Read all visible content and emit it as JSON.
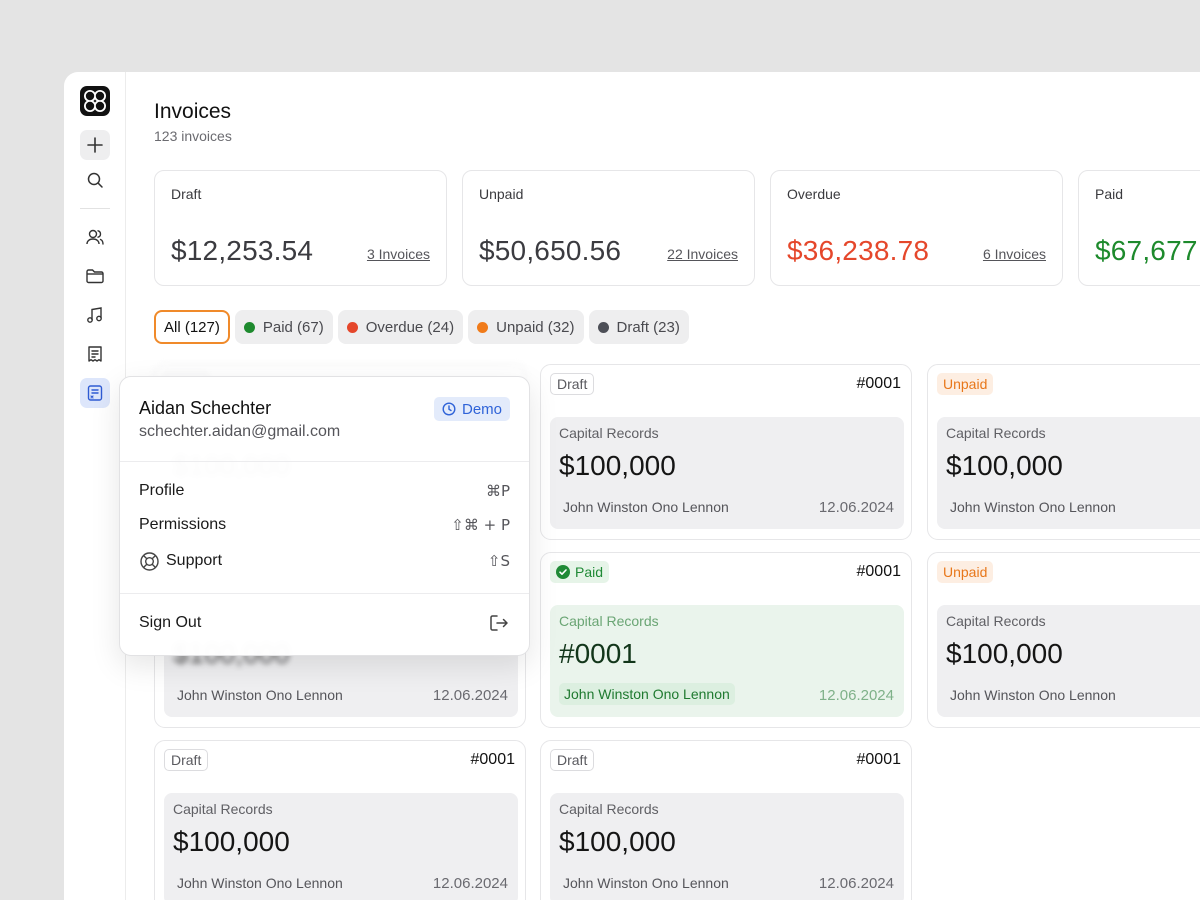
{
  "header": {
    "title": "Invoices",
    "subtitle": "123 invoices"
  },
  "summary": [
    {
      "label": "Draft",
      "amount": "$12,253.54",
      "link": "3 Invoices",
      "color": "#3b3b40"
    },
    {
      "label": "Unpaid",
      "amount": "$50,650.56",
      "link": "22 Invoices",
      "color": "#3b3b40"
    },
    {
      "label": "Overdue",
      "amount": "$36,238.78",
      "link": "6 Invoices",
      "color": "#e5472b"
    },
    {
      "label": "Paid",
      "amount": "$67,677.",
      "link": "",
      "color": "#1d8a2c"
    }
  ],
  "filters": [
    {
      "label": "All (127)",
      "dot": ""
    },
    {
      "label": "Paid (67)",
      "dot": "#1e8a2e"
    },
    {
      "label": "Overdue (24)",
      "dot": "#e5472b"
    },
    {
      "label": "Unpaid (32)",
      "dot": "#f07b1a"
    },
    {
      "label": "Draft (23)",
      "dot": "#4d4f57"
    }
  ],
  "invoices": [
    {
      "status": "Draft",
      "number": "#0001",
      "company": "Capital Records",
      "amount": "$100,000",
      "client": "John Winston Ono Lennon",
      "date": "12.06.2024"
    },
    {
      "status": "Unpaid",
      "number": "",
      "company": "Capital Records",
      "amount": "$100,000",
      "client": "John Winston Ono Lennon",
      "date": ""
    },
    {
      "status": "Paid",
      "number": "#0001",
      "company": "Capital Records",
      "amount": "#0001",
      "client": "John Winston Ono Lennon",
      "date": "12.06.2024"
    },
    {
      "status": "Unpaid",
      "number": "",
      "company": "Capital Records",
      "amount": "$100,000",
      "client": "John Winston Ono Lennon",
      "date": ""
    },
    {
      "status": "Draft",
      "number": "#0001",
      "company": "Capital Records",
      "amount": "$100,000",
      "client": "John Winston Ono Lennon",
      "date": "12.06.2024"
    },
    {
      "status": "Draft",
      "number": "#0001",
      "company": "Capital Records",
      "amount": "$100,000",
      "client": "John Winston Ono Lennon",
      "date": "12.06.2024"
    },
    {
      "status": "",
      "number": "",
      "company": "",
      "amount": "$100,000",
      "client": "John Winston Ono Lennon",
      "date": "12.06.2024"
    }
  ],
  "popover": {
    "name": "Aidan Schechter",
    "email": "schechter.aidan@gmail.com",
    "badge": "Demo",
    "items": [
      {
        "label": "Profile",
        "shortcut": "⌘P"
      },
      {
        "label": "Permissions",
        "shortcut": "⇧⌘ + P"
      },
      {
        "label": "Support",
        "shortcut": "⇧S"
      }
    ],
    "signout": "Sign Out"
  },
  "sidebar": {
    "icons": [
      "logo-icon",
      "plus-icon",
      "search-icon",
      "users-icon",
      "folder-icon",
      "music-icon",
      "receipt-icon",
      "invoice-icon"
    ]
  }
}
